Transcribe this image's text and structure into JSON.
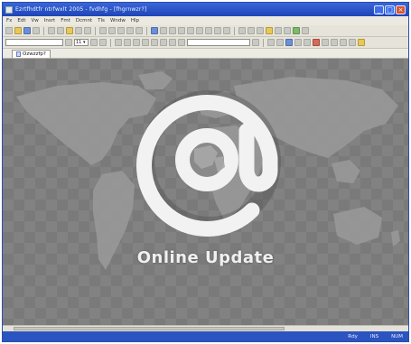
{
  "window": {
    "title": "Ezrtfhdtfr ntrfwxlt 2005 - fvdhfg - [fhgrnwzr?]",
    "min_label": "_",
    "max_label": "□",
    "close_label": "×"
  },
  "menu": [
    "Fx",
    "Edt",
    "Vw",
    "Insrt",
    "Fmt",
    "Dcmnt",
    "Tls",
    "Wndw",
    "Hlp"
  ],
  "toolbar2": {
    "font_combo": "",
    "size_combo": "11 ▾"
  },
  "tab": {
    "label": "Ozwzzfp?"
  },
  "content": {
    "headline": "Online Update",
    "at_symbol": "@"
  },
  "status": {
    "left": "",
    "right1": "Rdy",
    "right2": "INS",
    "right3": "NUM"
  },
  "colors": {
    "titlebar": "#1e45b8",
    "stage_bg": "#7a7a7a",
    "map_fill": "#9a9a9a",
    "at_fill": "#f2f2f2"
  }
}
